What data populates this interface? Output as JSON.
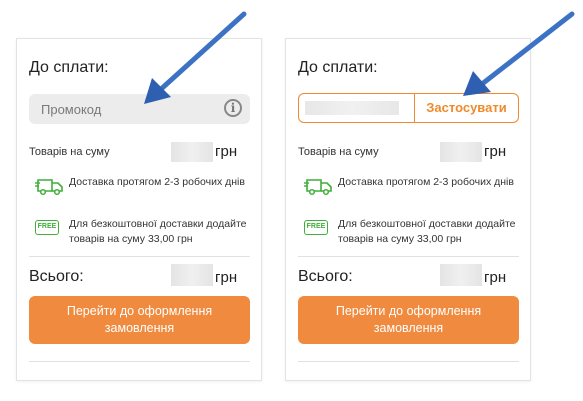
{
  "left_panel": {
    "title": "До сплати:",
    "promo_placeholder": "Промокод",
    "info_icon": "info-icon",
    "goods_label": "Товарів на суму",
    "currency": "грн",
    "delivery_text": "Доставка протягом 2-3 робочих днів",
    "free_badge": "FREE",
    "free_text": "Для безкоштовної доставки додайте товарів на суму 33,00 грн",
    "total_label": "Всього:",
    "total_currency": "грн",
    "checkout_label": "Перейти до оформлення замовлення"
  },
  "right_panel": {
    "title": "До сплати:",
    "apply_label": "Застосувати",
    "goods_label": "Товарів на суму",
    "currency": "грн",
    "delivery_text": "Доставка протягом 2-3 робочих днів",
    "free_badge": "FREE",
    "free_text": "Для безкоштовної доставки додайте товарів на суму 33,00 грн",
    "total_label": "Всього:",
    "total_currency": "грн",
    "checkout_label": "Перейти до оформлення замовлення"
  },
  "colors": {
    "accent": "#f08a3e",
    "free_green": "#3fae3a",
    "arrow_blue": "#3a6fc4"
  }
}
